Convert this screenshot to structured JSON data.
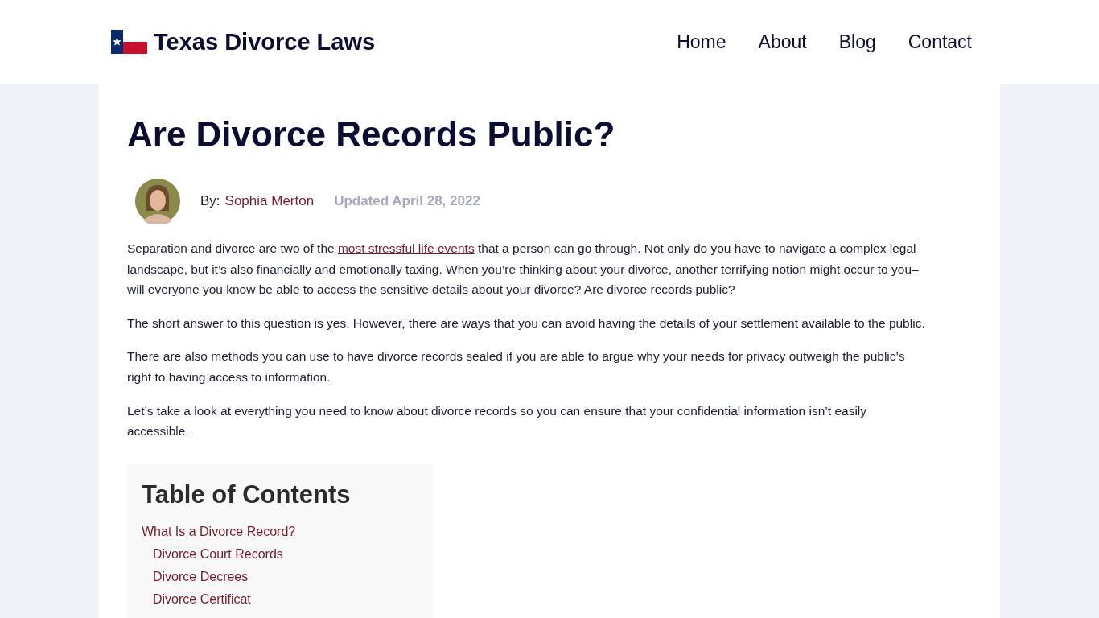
{
  "header": {
    "site_title": "Texas Divorce Laws",
    "nav": [
      {
        "label": "Home"
      },
      {
        "label": "About"
      },
      {
        "label": "Blog"
      },
      {
        "label": "Contact"
      }
    ]
  },
  "article": {
    "title": "Are Divorce Records Public?",
    "byline": {
      "prefix": "By:",
      "author": "Sophia Merton",
      "updated": "Updated April 28, 2022"
    },
    "paragraphs": [
      {
        "before": "Separation and divorce are two of the ",
        "link": "most stressful life events",
        "after": " that a person can go through. Not only do you have to navigate a complex legal landscape, but it’s also financially and emotionally taxing. When you’re thinking about your divorce, another terrifying notion might occur to you– will everyone you know be able to access the sensitive details about your divorce? Are divorce records public?"
      },
      {
        "before": "The short answer to this question is yes. However, there are ways that you can avoid having the details of your settlement available to the public."
      },
      {
        "before": "There are also methods you can use to have divorce records sealed if you are able to argue why your needs for privacy outweigh the public’s right to having access to information."
      },
      {
        "before": "Let’s take a look at everything you need to know about divorce records so you can ensure that your confidential information isn’t easily accessible."
      }
    ],
    "toc": {
      "title": "Table of Contents",
      "items": [
        {
          "label": "What Is a Divorce Record?",
          "children": [
            {
              "label": "Divorce Court Records"
            },
            {
              "label": "Divorce Decrees"
            },
            {
              "label": "Divorce Certificat"
            }
          ]
        }
      ]
    }
  }
}
